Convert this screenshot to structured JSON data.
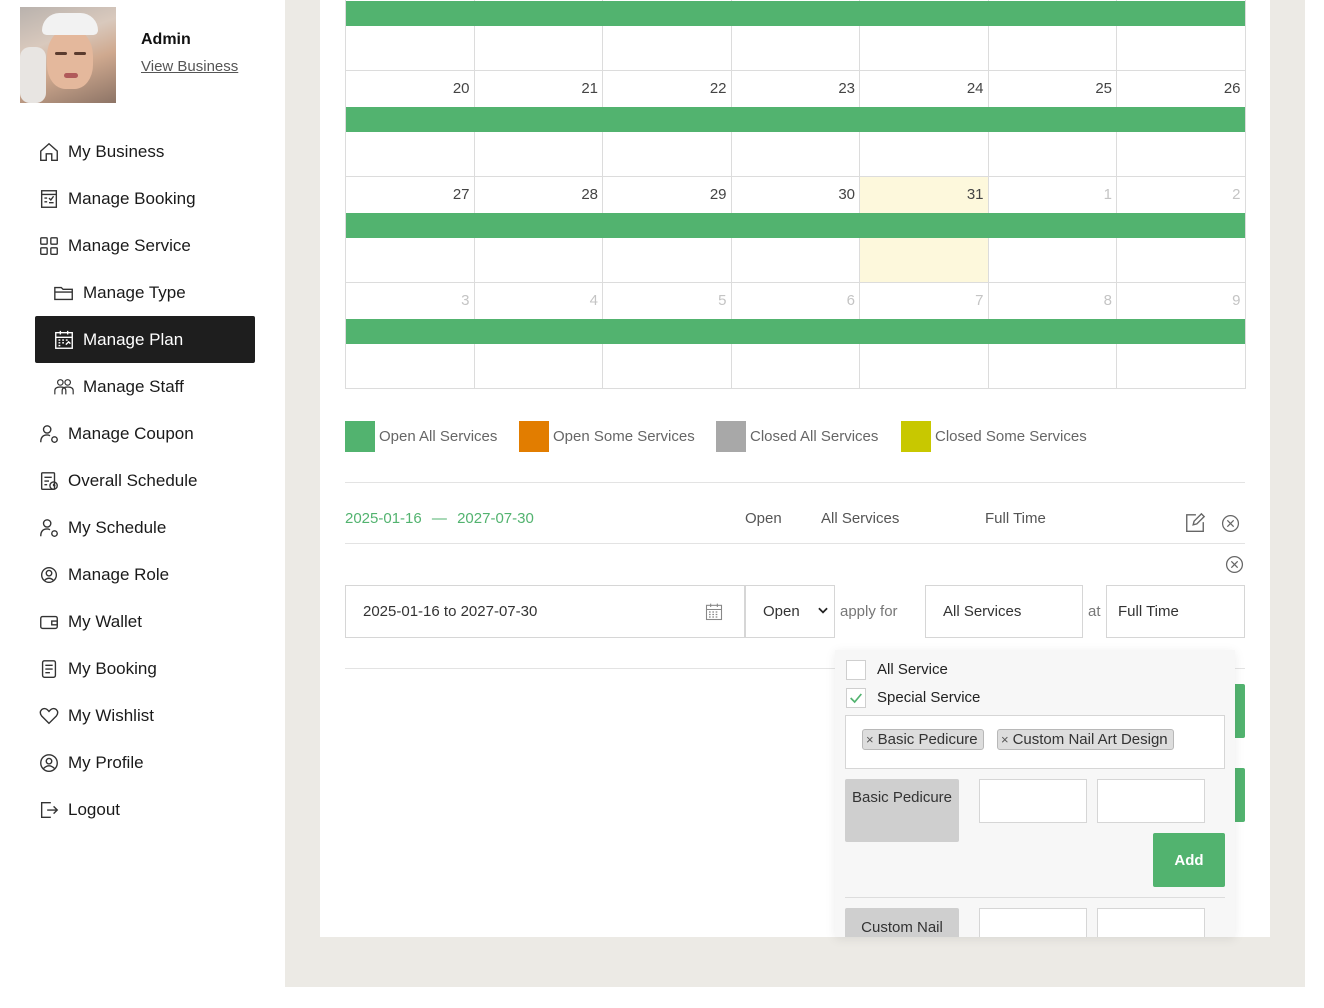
{
  "profile": {
    "name": "Admin",
    "view_link": "View Business"
  },
  "nav": [
    {
      "label": "My Business",
      "icon": "home-icon"
    },
    {
      "label": "Manage Booking",
      "icon": "booking-icon"
    },
    {
      "label": "Manage Service",
      "icon": "grid-icon"
    },
    {
      "label": "Manage Type",
      "icon": "folder-icon"
    },
    {
      "label": "Manage Plan",
      "icon": "calendar-plan-icon",
      "active": true
    },
    {
      "label": "Manage Staff",
      "icon": "staff-icon"
    },
    {
      "label": "Manage Coupon",
      "icon": "user-coupon-icon"
    },
    {
      "label": "Overall Schedule",
      "icon": "schedule-icon"
    },
    {
      "label": "My Schedule",
      "icon": "user-schedule-icon"
    },
    {
      "label": "Manage Role",
      "icon": "role-icon"
    },
    {
      "label": "My Wallet",
      "icon": "wallet-icon"
    },
    {
      "label": "My Booking",
      "icon": "list-icon"
    },
    {
      "label": "My Wishlist",
      "icon": "heart-icon"
    },
    {
      "label": "My Profile",
      "icon": "profile-icon"
    },
    {
      "label": "Logout",
      "icon": "logout-icon"
    }
  ],
  "calendar": {
    "rows": [
      [
        "",
        "",
        "",
        "",
        "",
        "",
        ""
      ],
      [
        "20",
        "21",
        "22",
        "23",
        "24",
        "25",
        "26"
      ],
      [
        "27",
        "28",
        "29",
        "30",
        "31",
        "1",
        "2"
      ],
      [
        "3",
        "4",
        "5",
        "6",
        "7",
        "8",
        "9"
      ]
    ],
    "today": "31",
    "open_color": "#52b36f"
  },
  "legend": [
    {
      "label": "Open All Services",
      "color": "#52b36f"
    },
    {
      "label": "Open Some Services",
      "color": "#e27d00"
    },
    {
      "label": "Closed All Services",
      "color": "#a8a8a8"
    },
    {
      "label": "Closed Some Services",
      "color": "#c8c800"
    }
  ],
  "plan": {
    "start": "2025-01-16",
    "sep": "—",
    "end": "2027-07-30",
    "status": "Open",
    "services": "All Services",
    "time": "Full Time"
  },
  "form": {
    "date_range": "2025-01-16 to 2027-07-30",
    "status": "Open",
    "apply_for": "apply for",
    "services": "All Services",
    "at": "at",
    "time": "Full Time"
  },
  "dropdown": {
    "all_service": "All Service",
    "special_service": "Special Service",
    "tags": [
      "Basic Pedicure",
      "Custom Nail Art Design"
    ],
    "tag_remove": "×",
    "service1": "Basic Pedicure",
    "service2": "Custom Nail",
    "add_label": "Add"
  }
}
